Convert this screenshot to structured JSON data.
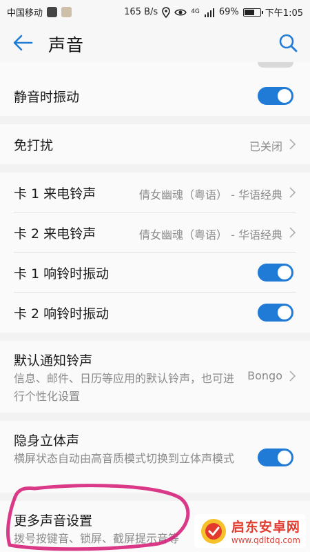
{
  "status_bar": {
    "carrier": "中国移动",
    "speed": "165 B/s",
    "network": "4G",
    "battery": "69%",
    "battery_level": 0.69,
    "time": "下午1:05"
  },
  "app_bar": {
    "title": "声音"
  },
  "groups": [
    {
      "rows": [
        {
          "title": "静音时振动",
          "toggle": true
        }
      ]
    },
    {
      "rows": [
        {
          "title": "免打扰",
          "value": "已关闭"
        }
      ]
    },
    {
      "rows": [
        {
          "title": "卡 1 来电铃声",
          "value": "倩女幽魂（粤语） - 华语经典"
        },
        {
          "title": "卡 2 来电铃声",
          "value": "倩女幽魂（粤语） - 华语经典"
        },
        {
          "title": "卡 1 响铃时振动",
          "toggle": true
        },
        {
          "title": "卡 2 响铃时振动",
          "toggle": true
        }
      ]
    },
    {
      "rows": [
        {
          "title": "默认通知铃声",
          "desc": "信息、邮件、日历等应用的默认铃声，也可进行个性化设置",
          "value": "Bongo"
        }
      ]
    },
    {
      "rows": [
        {
          "title": "隐身立体声",
          "desc": "横屏状态自动由高音质模式切换到立体声模式",
          "toggle": true
        }
      ]
    },
    {
      "rows": [
        {
          "title": "更多声音设置",
          "desc": "拨号按键音、锁屏、截屏提示音等"
        }
      ]
    }
  ],
  "watermark": {
    "name": "启东安卓网",
    "url": "www.qdltdq.com"
  },
  "colors": {
    "accent": "#1f7bd6",
    "annotation": "#d6237a",
    "watermark": "#e23b2e"
  }
}
